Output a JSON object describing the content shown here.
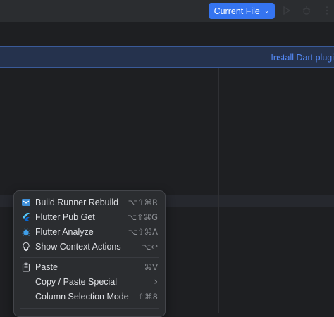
{
  "toolbar": {
    "run_config_label": "Current File",
    "run_config_chevron": "⌄",
    "icons": [
      "run-icon",
      "debug-icon",
      "more-icon"
    ]
  },
  "banner": {
    "link_text": "Install Dart plugi"
  },
  "context_menu": {
    "items": [
      {
        "label": "Build Runner Rebuild",
        "shortcut": "⌥⇧⌘R",
        "icon": "build-runner-icon"
      },
      {
        "label": "Flutter Pub Get",
        "shortcut": "⌥⇧⌘G",
        "icon": "flutter-icon"
      },
      {
        "label": "Flutter Analyze",
        "shortcut": "⌥⇧⌘A",
        "icon": "bug-icon"
      },
      {
        "label": "Show Context Actions",
        "shortcut": "⌥↩",
        "icon": "lightbulb-icon"
      },
      {
        "label": "Paste",
        "shortcut": "⌘V",
        "icon": "clipboard-icon"
      },
      {
        "label": "Copy / Paste Special",
        "shortcut": "›",
        "icon": ""
      },
      {
        "label": "Column Selection Mode",
        "shortcut": "⇧⌘8",
        "icon": ""
      }
    ]
  },
  "colors": {
    "accent": "#3574f0",
    "link": "#548af7",
    "menu_bg": "#2b2d30",
    "editor_bg": "#1e1f22"
  }
}
